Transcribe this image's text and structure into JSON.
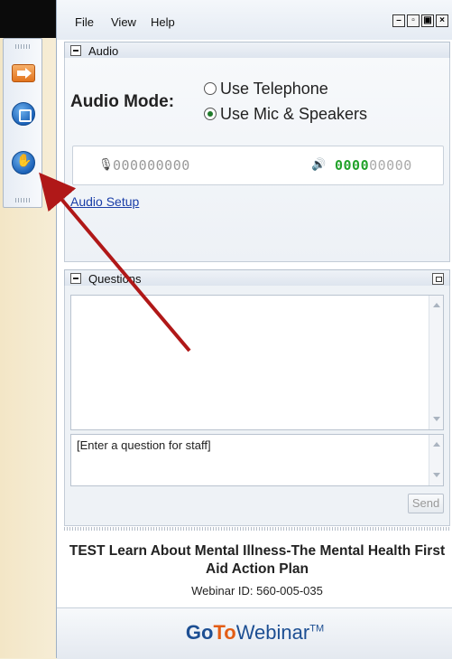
{
  "menu": {
    "file": "File",
    "view": "View",
    "help": "Help"
  },
  "audio": {
    "section_title": "Audio",
    "mode_label": "Audio Mode:",
    "option_telephone": "Use Telephone",
    "option_mic": "Use Mic & Speakers",
    "selected": "Use Mic & Speakers",
    "mic_level_dots": "000000000",
    "speaker_level_lit": "0000",
    "speaker_level_unlit": "00000",
    "setup_link": "Audio Setup"
  },
  "questions": {
    "section_title": "Questions",
    "input_placeholder": "[Enter a question for staff]",
    "send_label": "Send"
  },
  "webinar": {
    "title": "TEST Learn About Mental Illness-The Mental Health First Aid Action Plan",
    "id_text": "Webinar ID: 560-005-035"
  },
  "brand": {
    "go": "Go",
    "to": "To",
    "webinar": "Webinar",
    "tm": "TM"
  },
  "icons": {
    "toolbar": [
      "arrow-icon",
      "screen-icon",
      "raise-hand-icon"
    ],
    "annotation_color": "#b01818"
  }
}
